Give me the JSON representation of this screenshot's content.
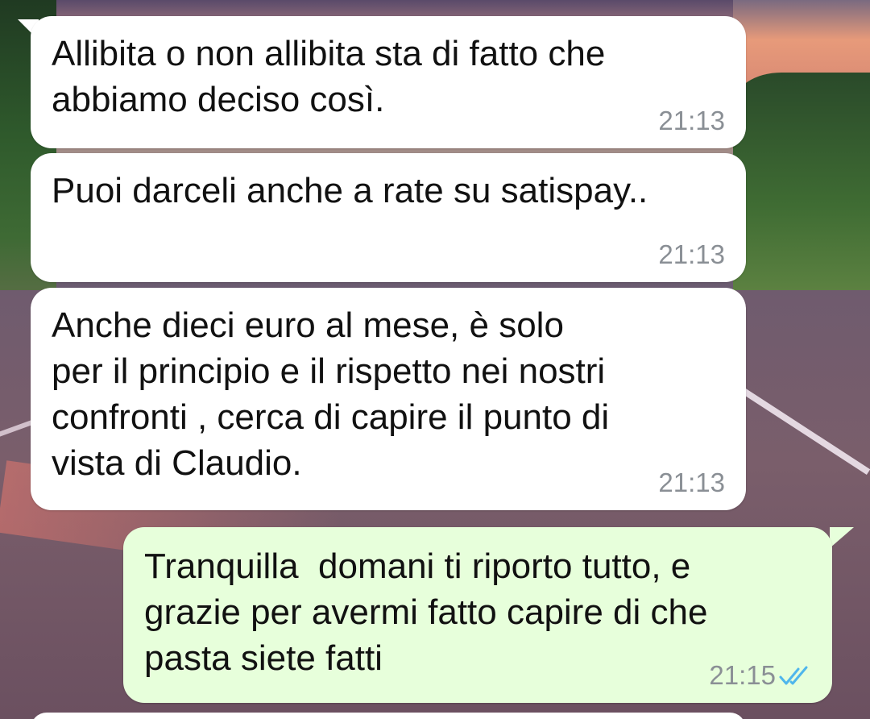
{
  "colors": {
    "incoming_bubble": "#ffffff",
    "outgoing_bubble": "#e7ffdb",
    "timestamp": "#8a8f95",
    "read_ticks": "#4fb6ec"
  },
  "messages": [
    {
      "direction": "incoming",
      "text": "Allibita o non allibita sta di fatto che\nabbiamo deciso così.",
      "time": "21:13"
    },
    {
      "direction": "incoming",
      "text": "Puoi darceli anche a rate su satispay..",
      "time": "21:13"
    },
    {
      "direction": "incoming",
      "text": "Anche dieci euro al mese, è solo\nper il principio e il rispetto nei nostri\nconfronti , cerca di capire il punto di\nvista di Claudio.",
      "time": "21:13"
    },
    {
      "direction": "outgoing",
      "text": "Tranquilla  domani ti riporto tutto, e\ngrazie per avermi fatto capire di che\npasta siete fatti",
      "time": "21:15",
      "status_icon": "double-check-read-icon"
    }
  ]
}
